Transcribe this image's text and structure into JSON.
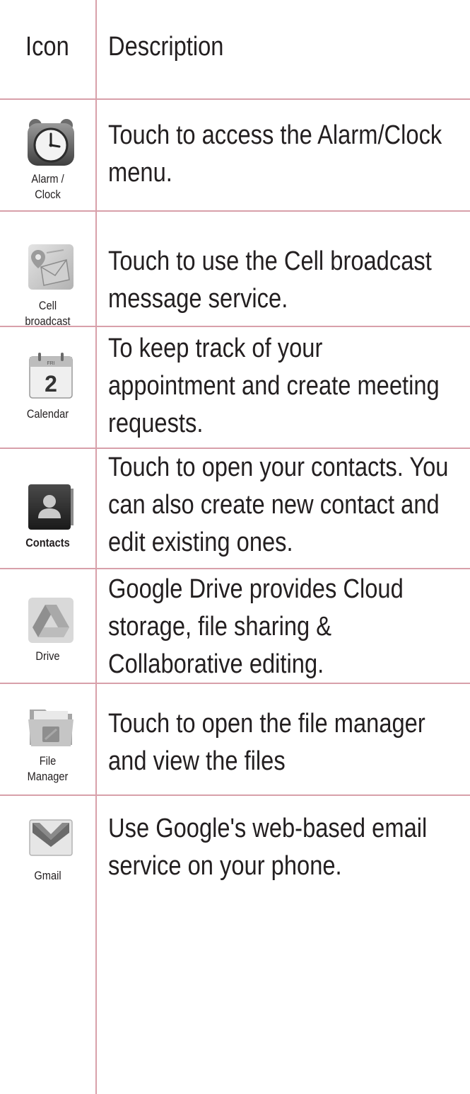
{
  "header": {
    "icon_label": "Icon",
    "description_label": "Description"
  },
  "rows": [
    {
      "icon": "alarm-clock-icon",
      "label_lines": [
        "Alarm /",
        "Clock"
      ],
      "description_lines": [
        "Touch to access the Alarm/Clock",
        "menu."
      ]
    },
    {
      "icon": "cell-broadcast-icon",
      "label_lines": [
        "Cell",
        "broadcast"
      ],
      "description_lines": [
        "Touch to use the Cell broadcast",
        "message service."
      ]
    },
    {
      "icon": "calendar-icon",
      "icon_text": "2",
      "label_lines": [
        "Calendar"
      ],
      "description_lines": [
        "To keep track of your",
        "appointment and create meeting",
        "requests."
      ]
    },
    {
      "icon": "contacts-icon",
      "label_lines": [
        "Contacts"
      ],
      "description_lines": [
        "Touch to open your contacts. You",
        "can also create new contact and",
        "edit existing ones."
      ]
    },
    {
      "icon": "drive-icon",
      "label_lines": [
        "Drive"
      ],
      "description_lines": [
        "Google Drive provides Cloud",
        "storage, file sharing &",
        "Collaborative editing."
      ]
    },
    {
      "icon": "file-manager-icon",
      "label_lines": [
        "File",
        "Manager"
      ],
      "description_lines": [
        "Touch to open the file manager",
        "and view the files"
      ]
    },
    {
      "icon": "gmail-icon",
      "label_lines": [
        "Gmail"
      ],
      "description_lines": [
        "Use Google's web-based email",
        "service on your phone."
      ]
    }
  ],
  "colors": {
    "rule": "#d8a0aa",
    "text": "#231f20"
  }
}
